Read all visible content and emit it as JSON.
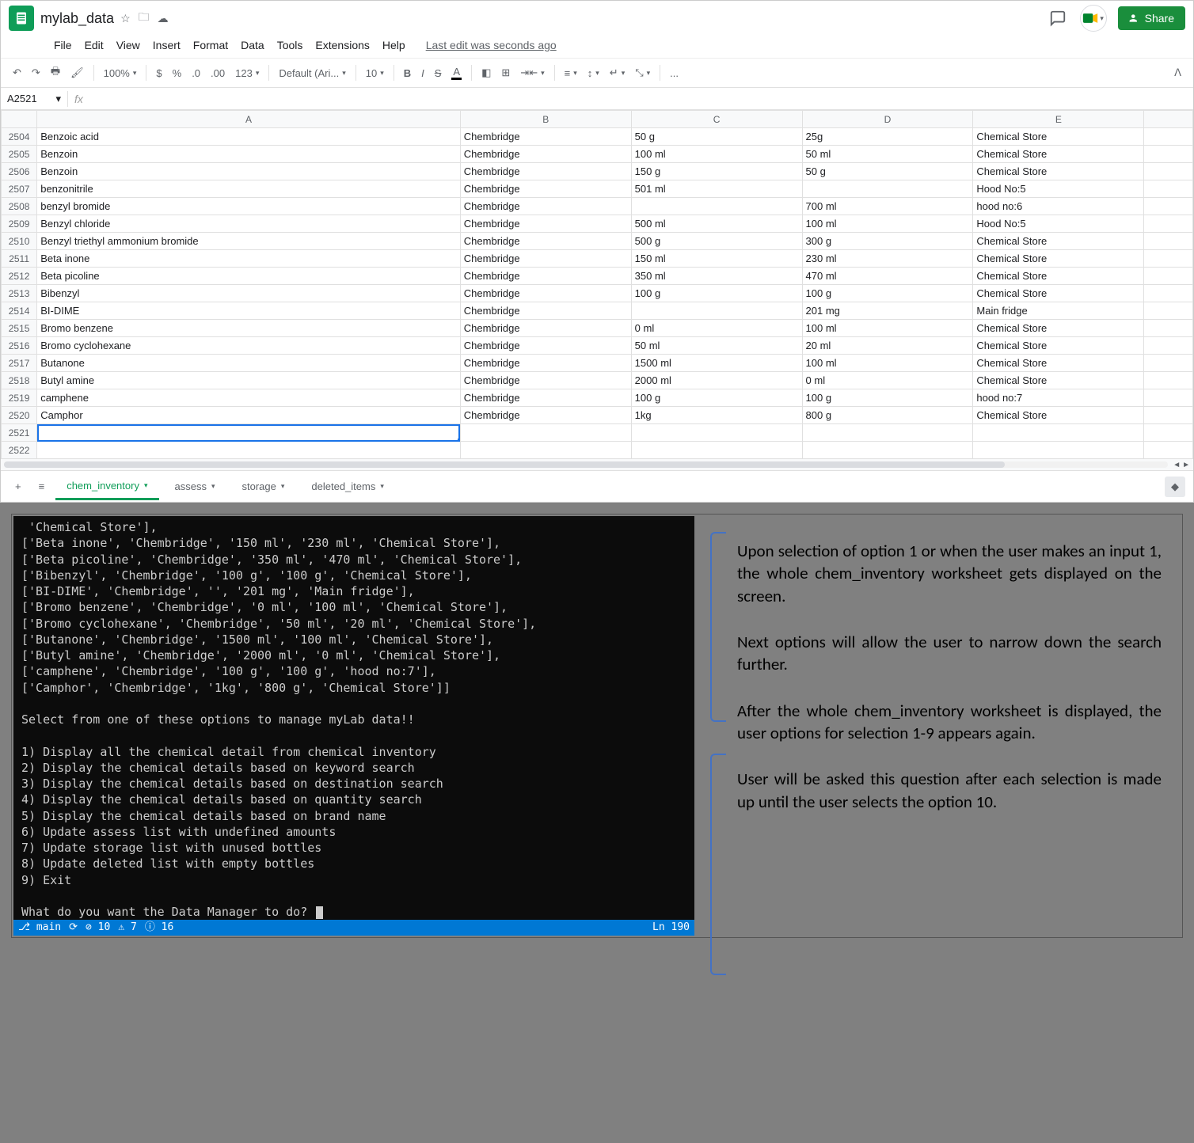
{
  "doc": {
    "title": "mylab_data",
    "lastEdit": "Last edit was seconds ago"
  },
  "menus": [
    "File",
    "Edit",
    "View",
    "Insert",
    "Format",
    "Data",
    "Tools",
    "Extensions",
    "Help"
  ],
  "toolbar": {
    "zoom": "100%",
    "currency": "$",
    "percent": "%",
    "dec1": ".0",
    "dec2": ".00",
    "num": "123",
    "font": "Default (Ari...",
    "size": "10",
    "more": "..."
  },
  "share": "Share",
  "namebox": "A2521",
  "columns": [
    "A",
    "B",
    "C",
    "D",
    "E"
  ],
  "rows": [
    {
      "n": "2504",
      "a": "Benzoic acid",
      "b": "Chembridge",
      "c": "50 g",
      "d": "25g",
      "e": "Chemical Store"
    },
    {
      "n": "2505",
      "a": "Benzoin",
      "b": "Chembridge",
      "c": "100 ml",
      "d": "50 ml",
      "e": "Chemical Store"
    },
    {
      "n": "2506",
      "a": "Benzoin",
      "b": "Chembridge",
      "c": "150 g",
      "d": "50 g",
      "e": "Chemical Store"
    },
    {
      "n": "2507",
      "a": "benzonitrile",
      "b": "Chembridge",
      "c": "501 ml",
      "d": "",
      "e": "Hood No:5"
    },
    {
      "n": "2508",
      "a": "benzyl bromide",
      "b": "Chembridge",
      "c": "",
      "d": "700 ml",
      "e": "hood no:6"
    },
    {
      "n": "2509",
      "a": "Benzyl chloride",
      "b": "Chembridge",
      "c": "500 ml",
      "d": "100 ml",
      "e": "Hood No:5"
    },
    {
      "n": "2510",
      "a": "Benzyl triethyl ammonium bromide",
      "b": "Chembridge",
      "c": "500 g",
      "d": "300 g",
      "e": "Chemical Store"
    },
    {
      "n": "2511",
      "a": "Beta inone",
      "b": "Chembridge",
      "c": "150 ml",
      "d": "230 ml",
      "e": "Chemical Store"
    },
    {
      "n": "2512",
      "a": "Beta picoline",
      "b": "Chembridge",
      "c": "350 ml",
      "d": "470 ml",
      "e": "Chemical Store"
    },
    {
      "n": "2513",
      "a": "Bibenzyl",
      "b": "Chembridge",
      "c": "100 g",
      "d": "100 g",
      "e": "Chemical Store"
    },
    {
      "n": "2514",
      "a": "BI-DIME",
      "b": "Chembridge",
      "c": "",
      "d": "201 mg",
      "e": "Main fridge"
    },
    {
      "n": "2515",
      "a": "Bromo benzene",
      "b": "Chembridge",
      "c": "0 ml",
      "d": "100 ml",
      "e": "Chemical Store"
    },
    {
      "n": "2516",
      "a": "Bromo cyclohexane",
      "b": "Chembridge",
      "c": "50 ml",
      "d": "20 ml",
      "e": "Chemical Store"
    },
    {
      "n": "2517",
      "a": "Butanone",
      "b": "Chembridge",
      "c": "1500 ml",
      "d": "100 ml",
      "e": "Chemical Store"
    },
    {
      "n": "2518",
      "a": "Butyl amine",
      "b": "Chembridge",
      "c": "2000 ml",
      "d": "0 ml",
      "e": "Chemical Store"
    },
    {
      "n": "2519",
      "a": "camphene",
      "b": "Chembridge",
      "c": "100 g",
      "d": "100 g",
      "e": "hood no:7"
    },
    {
      "n": "2520",
      "a": "Camphor",
      "b": "Chembridge",
      "c": "1kg",
      "d": "800 g",
      "e": "Chemical Store"
    },
    {
      "n": "2521",
      "a": "",
      "b": "",
      "c": "",
      "d": "",
      "e": ""
    },
    {
      "n": "2522",
      "a": "",
      "b": "",
      "c": "",
      "d": "",
      "e": ""
    }
  ],
  "tabs": [
    {
      "label": "chem_inventory",
      "active": true
    },
    {
      "label": "assess",
      "active": false
    },
    {
      "label": "storage",
      "active": false
    },
    {
      "label": "deleted_items",
      "active": false
    }
  ],
  "terminal": {
    "lines": [
      " 'Chemical Store'],",
      "['Beta inone', 'Chembridge', '150 ml', '230 ml', 'Chemical Store'],",
      "['Beta picoline', 'Chembridge', '350 ml', '470 ml', 'Chemical Store'],",
      "['Bibenzyl', 'Chembridge', '100 g', '100 g', 'Chemical Store'],",
      "['BI-DIME', 'Chembridge', '', '201 mg', 'Main fridge'],",
      "['Bromo benzene', 'Chembridge', '0 ml', '100 ml', 'Chemical Store'],",
      "['Bromo cyclohexane', 'Chembridge', '50 ml', '20 ml', 'Chemical Store'],",
      "['Butanone', 'Chembridge', '1500 ml', '100 ml', 'Chemical Store'],",
      "['Butyl amine', 'Chembridge', '2000 ml', '0 ml', 'Chemical Store'],",
      "['camphene', 'Chembridge', '100 g', '100 g', 'hood no:7'],",
      "['Camphor', 'Chembridge', '1kg', '800 g', 'Chemical Store']]",
      "",
      "Select from one of these options to manage myLab data!!",
      "",
      "1) Display all the chemical detail from chemical inventory",
      "2) Display the chemical details based on keyword search",
      "3) Display the chemical details based on destination search",
      "4) Display the chemical details based on quantity search",
      "5) Display the chemical details based on brand name",
      "6) Update assess list with undefined amounts",
      "7) Update storage list with unused bottles",
      "8) Update deleted list with empty bottles",
      "9) Exit",
      "",
      "What do you want the Data Manager to do? "
    ],
    "status": {
      "branch": "main",
      "errors": "⊘ 10",
      "warn": "⚠ 7",
      "info": "ⓘ 16",
      "line": "Ln 190"
    }
  },
  "annotations": {
    "p1": "Upon selection of option 1 or when the user makes an input 1, the whole chem_inventory worksheet gets displayed on the screen.",
    "p2": "Next options will allow the user to narrow down the search further.",
    "p3": "After the whole chem_inventory worksheet is displayed, the user options for selection 1-9 appears again.",
    "p4": "User will be asked this question  after each selection is made up until the user selects the option 10."
  }
}
